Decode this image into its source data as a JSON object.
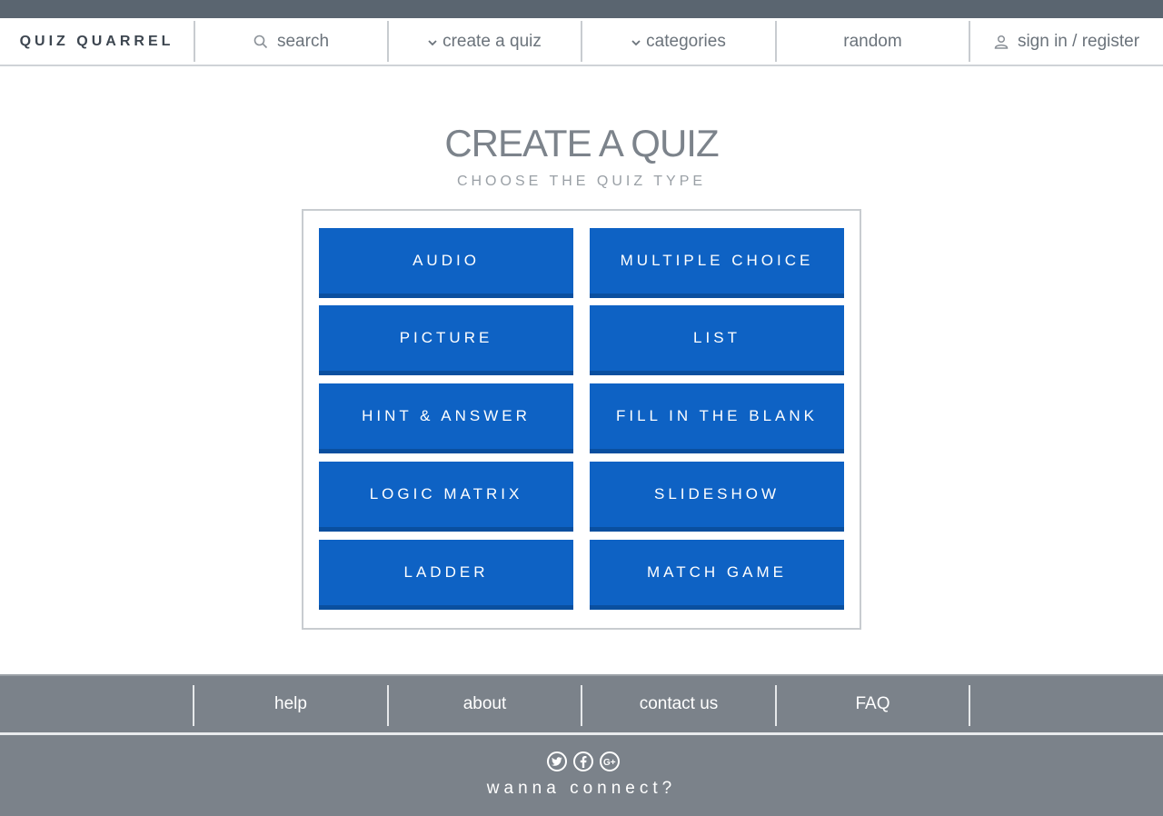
{
  "header": {
    "logo": "QUIZ QUARREL",
    "nav": {
      "search": "search",
      "create": "create a quiz",
      "categories": "categories",
      "random": "random",
      "signin": "sign in / register"
    }
  },
  "main": {
    "title": "CREATE A QUIZ",
    "subtitle": "CHOOSE THE QUIZ TYPE",
    "quiz_types": [
      "AUDIO",
      "MULTIPLE CHOICE",
      "PICTURE",
      "LIST",
      "HINT & ANSWER",
      "FILL IN THE BLANK",
      "LOGIC MATRIX",
      "SLIDESHOW",
      "LADDER",
      "MATCH GAME"
    ]
  },
  "footer": {
    "links": [
      "help",
      "about",
      "contact us",
      "FAQ"
    ],
    "social_icons": [
      "twitter-icon",
      "facebook-icon",
      "google-plus-icon"
    ],
    "connect": "wanna connect?"
  },
  "colors": {
    "button": "#0e62c4",
    "footer": "#7b828a",
    "topbar": "#5a6570"
  }
}
